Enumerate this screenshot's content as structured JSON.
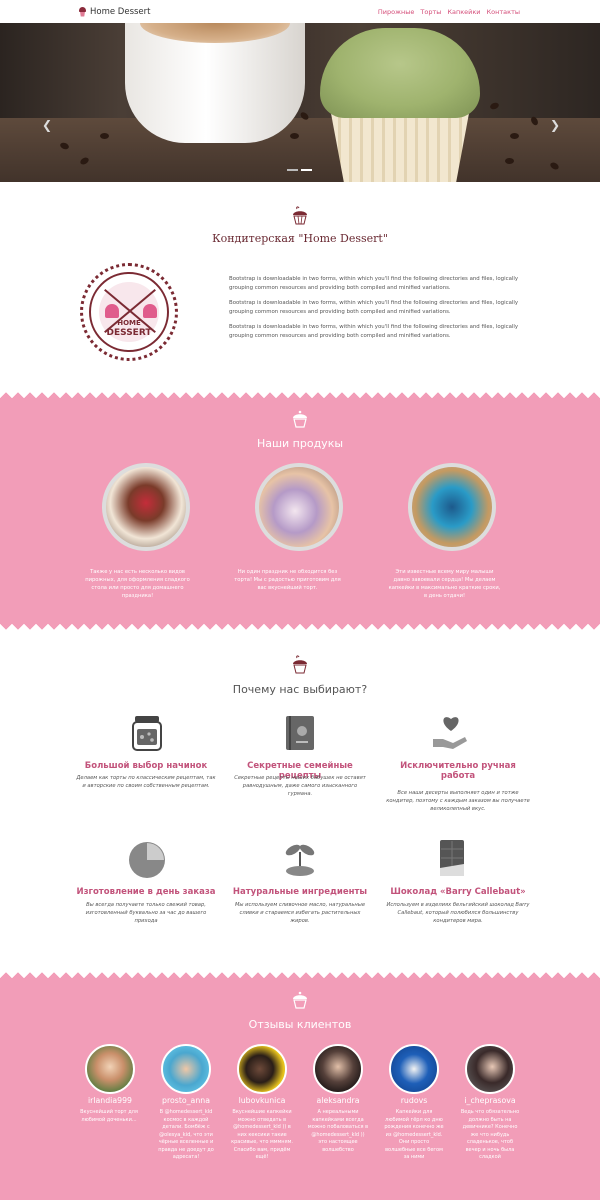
{
  "navbar": {
    "brand": "Home Dessert",
    "menu": [
      "Пирожные",
      "Торты",
      "Капкейки",
      "Контакты"
    ]
  },
  "hero": {
    "prev_icon": "chevron-left-icon",
    "next_icon": "chevron-right-icon",
    "indicators": 2,
    "active_indicator": 1
  },
  "about": {
    "title": "Кондитерская \"Home Dessert\"",
    "logo_line1": "HOME",
    "logo_line2": "DESSERT",
    "paragraphs": [
      "Bootstrap is downloadable in two forms, within which you'll find the following directories and files, logically grouping common resources and providing both compiled and minified variations.",
      "Bootstrap is downloadable in two forms, within which you'll find the following directories and files, logically grouping common resources and providing both compiled and minified variations.",
      "Bootstrap is downloadable in two forms, within which you'll find the following directories and files, logically grouping common resources and providing both compiled and minified variations."
    ]
  },
  "products": {
    "title": "Наши продукы",
    "items": [
      {
        "desc": "Также у нас есть несколько видов пирожных, для оформления сладкого стола или просто для домашнего праздника!"
      },
      {
        "desc": "Ни один праздник не обходится без торта! Мы с радостью приготовим для вас вкуснейший торт."
      },
      {
        "desc": "Эти известные всему миру малыши давно завоевали сердца! Мы делаем капкейки в максимально краткие сроки, в день отдачи!"
      }
    ]
  },
  "why": {
    "title": "Почему нас выбирают?",
    "features": [
      {
        "icon": "jar-icon",
        "title": "Большой выбор начинок",
        "desc": "Делаем как торты по классическим рецептам, так и авторские по своим собственным рецептам."
      },
      {
        "icon": "recipe-book-icon",
        "title": "Секретные семейные рецепты",
        "desc": "Секретные рецепты наших бабушек не оставят равнодушным, даже самого изысканного гурмана."
      },
      {
        "icon": "heart-hand-icon",
        "title": "Исключительно ручная работа",
        "desc": "Все наши десерты выполняет один и тотже кондитер, поэтому с каждым заказом вы получаете великолепный вкус."
      },
      {
        "icon": "clock-icon",
        "title": "Изготовление в день заказа",
        "desc": "Вы всегда получаете только свежий товар, изготовленный буквально за час до вашего прихода"
      },
      {
        "icon": "plant-icon",
        "title": "Натуральные ингредиенты",
        "desc": "Мы используем сливочное масло, натуральные сливки и стараемся избегать растительных жиров."
      },
      {
        "icon": "chocolate-icon",
        "title": "Шоколад «Barry Callebaut»",
        "desc": "Используем в изделиях бельгийский шоколад Barry Callebaut, который полюбился большинству кондитеров мира."
      }
    ]
  },
  "reviews": {
    "title": "Отзывы клиентов",
    "items": [
      {
        "name": "irlandia999",
        "text": "Вкуснейший торт для любимой доченьки..."
      },
      {
        "name": "prosto_anna",
        "text": "В @homedessert_kld космос в каждой детали. Бомбёж с @olesya_kid, что эти чёрные вселенные и правда не доедут до адресата!"
      },
      {
        "name": "lubovkunica",
        "text": "Вкуснейшие капкейки можно отведать в @homedessert_kld )) в них кексики такие красивые, что мммням. Спасибо вам, придём ещё!"
      },
      {
        "name": "aleksandra",
        "text": "А нереальными капкейками всегда можно побаловаться в @homedessert_kld )) это настоящее волшебство"
      },
      {
        "name": "rudovs",
        "text": "Капкейки для любимой гёрл ко дню рождения конечно же из @homedessert_kld. Они просто волшебные все бегом за ними"
      },
      {
        "name": "i_cheprasova",
        "text": "Ведь что обязательно должно быть на девичнике? Конечно же что нибудь сладенькое, чтоб вечер и ночь была сладкой"
      }
    ]
  },
  "colors": {
    "accent_pink": "#f29db8",
    "title_maroon": "#6a2a33",
    "feature_title": "#c2537b",
    "menu_link": "#d44f7a"
  }
}
